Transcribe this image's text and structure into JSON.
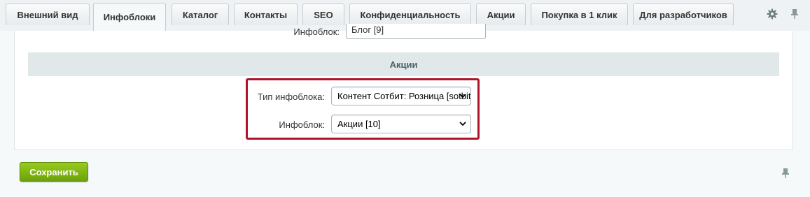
{
  "tabs": [
    {
      "label": "Внешний вид",
      "active": false
    },
    {
      "label": "Инфоблоки",
      "active": true
    },
    {
      "label": "Каталог",
      "active": false
    },
    {
      "label": "Контакты",
      "active": false
    },
    {
      "label": "SEO",
      "active": false
    },
    {
      "label": "Конфиденциальность",
      "active": false
    },
    {
      "label": "Акции",
      "active": false
    },
    {
      "label": "Покупка в 1 клик",
      "active": false
    },
    {
      "label": "Для разработчиков",
      "active": false
    }
  ],
  "toolbar_icons": [
    "gear-icon",
    "pin-icon"
  ],
  "previous_row": {
    "label": "Инфоблок:",
    "value": "Блог [9]"
  },
  "section": {
    "title": "Акции",
    "fields": [
      {
        "label": "Тип инфоблока:",
        "value": "Контент Сотбит: Розница [sotbit_origami_content]"
      },
      {
        "label": "Инфоблок:",
        "value": "Акции [10]"
      }
    ]
  },
  "footer": {
    "save_label": "Сохранить",
    "pin_icon": "pin-icon"
  },
  "colors": {
    "highlight": "#b0142a",
    "save_button": "#7fb215",
    "section_bg": "#e0e8ea"
  }
}
